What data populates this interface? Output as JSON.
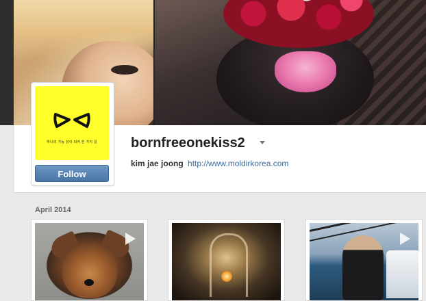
{
  "profile": {
    "username": "bornfreeonekiss2",
    "full_name": "kim jae joong",
    "website": "http://www.moldirkorea.com",
    "avatar_text": "하나의 가능 성이 되어 한 가지 길",
    "follow_label": "Follow"
  },
  "feed": {
    "month_label": "April 2014",
    "items": [
      {
        "type": "video",
        "icon": "play-icon"
      },
      {
        "type": "photo"
      },
      {
        "type": "video",
        "icon": "play-icon"
      }
    ]
  },
  "colors": {
    "follow_button": "#4a76a5",
    "link": "#3f6c9a",
    "avatar_bg": "#ffff2b"
  }
}
